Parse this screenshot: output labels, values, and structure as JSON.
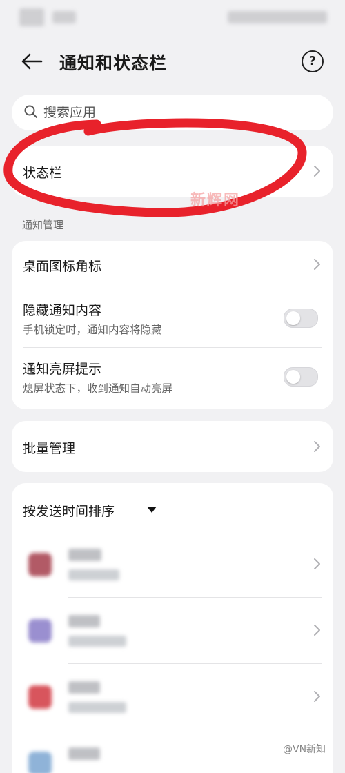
{
  "header": {
    "title": "通知和状态栏",
    "back_icon": "arrow-left-icon",
    "help_icon": "question-circle-icon"
  },
  "search": {
    "placeholder": "搜索应用"
  },
  "status_bar_item": {
    "label": "状态栏"
  },
  "section": {
    "label": "通知管理"
  },
  "settings": {
    "badge": {
      "title": "桌面图标角标"
    },
    "hide_content": {
      "title": "隐藏通知内容",
      "subtitle": "手机锁定时，通知内容将隐藏",
      "enabled": false
    },
    "wake_screen": {
      "title": "通知亮屏提示",
      "subtitle": "熄屏状态下，收到通知自动亮屏",
      "enabled": false
    }
  },
  "batch": {
    "label": "批量管理"
  },
  "sort": {
    "label": "按发送时间排序"
  },
  "watermark": {
    "center": "新辉网",
    "corner": "@VN新知"
  },
  "colors": {
    "annotation": "#e8222b",
    "background": "#f1f1f3",
    "card": "#ffffff"
  }
}
